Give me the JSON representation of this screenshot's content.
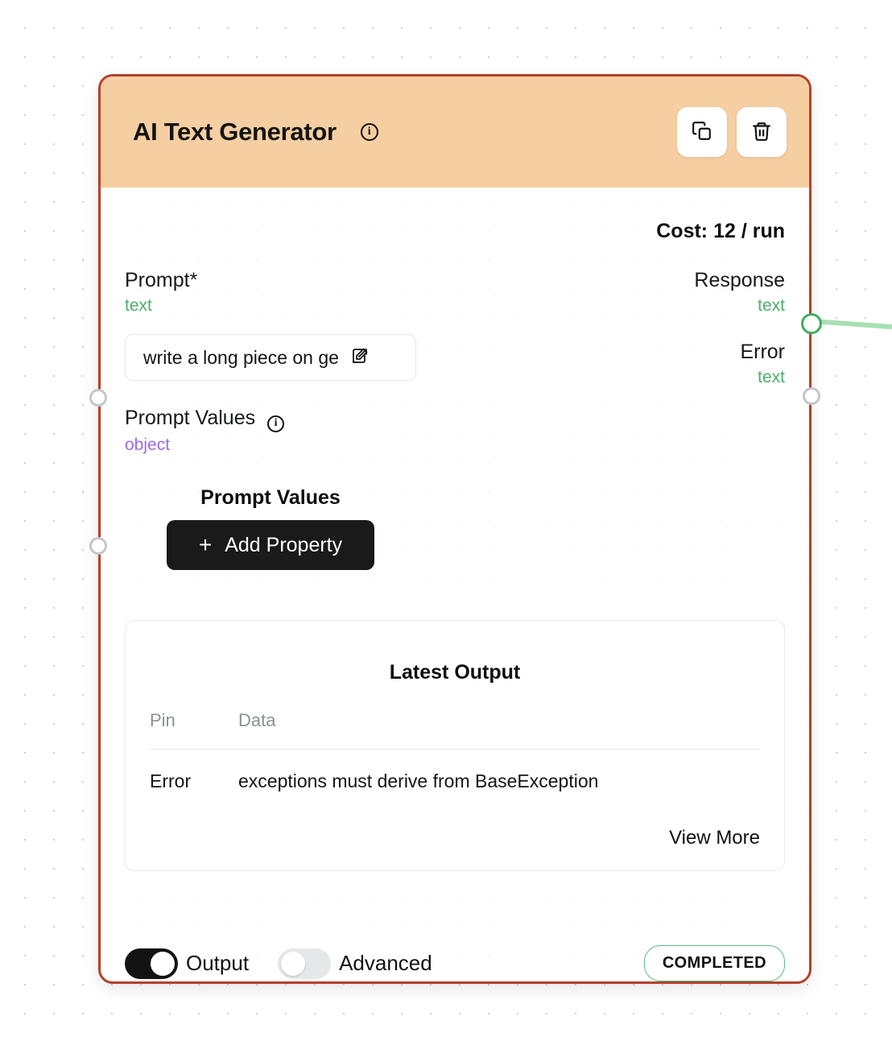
{
  "node": {
    "title": "AI Text Generator",
    "title_info_icon": "info-icon",
    "copy_icon": "copy-icon",
    "delete_icon": "trash-icon",
    "cost_label": "Cost: 12 / run",
    "border_color": "#b5402c",
    "header_color": "#f5cfa2"
  },
  "inputs": [
    {
      "label": "Prompt*",
      "type": "text",
      "type_color": "#4caf68",
      "has_info": false,
      "port_state": "unconnected"
    },
    {
      "label": "Prompt Values",
      "type": "object",
      "type_color": "#9b6bdf",
      "has_info": true,
      "port_state": "unconnected"
    }
  ],
  "outputs": [
    {
      "label": "Response",
      "type": "text",
      "type_color": "#4caf68",
      "port_state": "connected",
      "port_color": "#3fae5f"
    },
    {
      "label": "Error",
      "type": "text",
      "type_color": "#4caf68",
      "port_state": "unconnected",
      "port_color": "#c3c6cb"
    }
  ],
  "prompt_field": {
    "value": "write a long piece on ge",
    "edit_icon": "edit-icon"
  },
  "prompt_values": {
    "heading": "Prompt Values",
    "add_button_label": "Add Property",
    "add_button_icon": "plus-icon"
  },
  "latest_output": {
    "title": "Latest Output",
    "columns": [
      "Pin",
      "Data"
    ],
    "rows": [
      {
        "pin": "Error",
        "data": "exceptions must derive from BaseException"
      }
    ],
    "view_more_label": "View More"
  },
  "footer": {
    "output_toggle": {
      "label": "Output",
      "state": "on"
    },
    "advanced_toggle": {
      "label": "Advanced",
      "state": "off"
    },
    "status": {
      "label": "COMPLETED",
      "color": "#58bd7c"
    }
  }
}
